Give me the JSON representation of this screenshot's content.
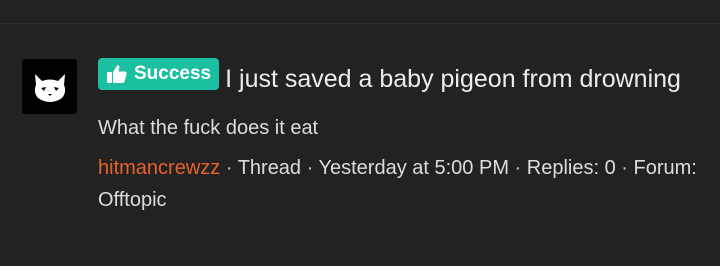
{
  "result": {
    "badge": {
      "label": "Success",
      "color": "#1bc0a0",
      "icon": "thumbs-up-icon"
    },
    "title": "I just saved a baby pigeon from drowning",
    "snippet": "What the fuck does it eat",
    "author": "hitmancrewzz",
    "author_color": "#e8622a",
    "type": "Thread",
    "time": "Yesterday at 5:00 PM",
    "replies_label": "Replies: 0",
    "forum_label": "Forum: Offtopic",
    "avatar_icon": "cat-icon"
  }
}
